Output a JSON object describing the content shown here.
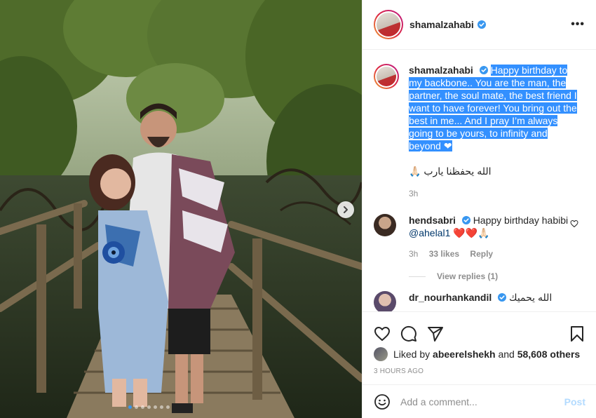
{
  "post": {
    "username": "shamalzahabi",
    "verified": true,
    "more_label": "•••"
  },
  "caption": {
    "username": "shamalzahabi",
    "text": "Happy birthday to my backbone.. You are the man, the partner, the soul mate, the best friend I want to have forever! You bring out the best in me... And I pray I’m always going to be yours, to infinity and beyond ❤",
    "arabic": "الله يحفظنا يارب 🙏🏻",
    "time": "3h"
  },
  "comments": [
    {
      "username": "hendsabri",
      "text": "Happy birthday habibi",
      "mention": "@ahelal1",
      "emoji": "❤️❤️🙏🏻",
      "time": "3h",
      "likes": "33 likes",
      "reply_label": "Reply",
      "view_replies": "View replies (1)"
    },
    {
      "username": "dr_nourhankandil",
      "text": "الله يحميك"
    }
  ],
  "likes": {
    "prefix": "Liked by",
    "user": "abeerelshekh",
    "middle": "and",
    "others": "58,608 others"
  },
  "timestamp": "3 HOURS AGO",
  "add_comment": {
    "placeholder": "Add a comment...",
    "post_label": "Post"
  },
  "carousel": {
    "total": 7,
    "active_index": 0
  },
  "icons": {
    "like": "heart-icon",
    "comment": "comment-icon",
    "share": "share-icon",
    "save": "bookmark-icon",
    "emoji": "emoji-icon",
    "next": "chevron-right-icon",
    "verified": "verified-badge-icon"
  },
  "colors": {
    "verified_blue": "#3897f0",
    "selection_blue": "#3390ff",
    "post_disabled": "#b3dbff",
    "muted": "#8e8e8e"
  }
}
